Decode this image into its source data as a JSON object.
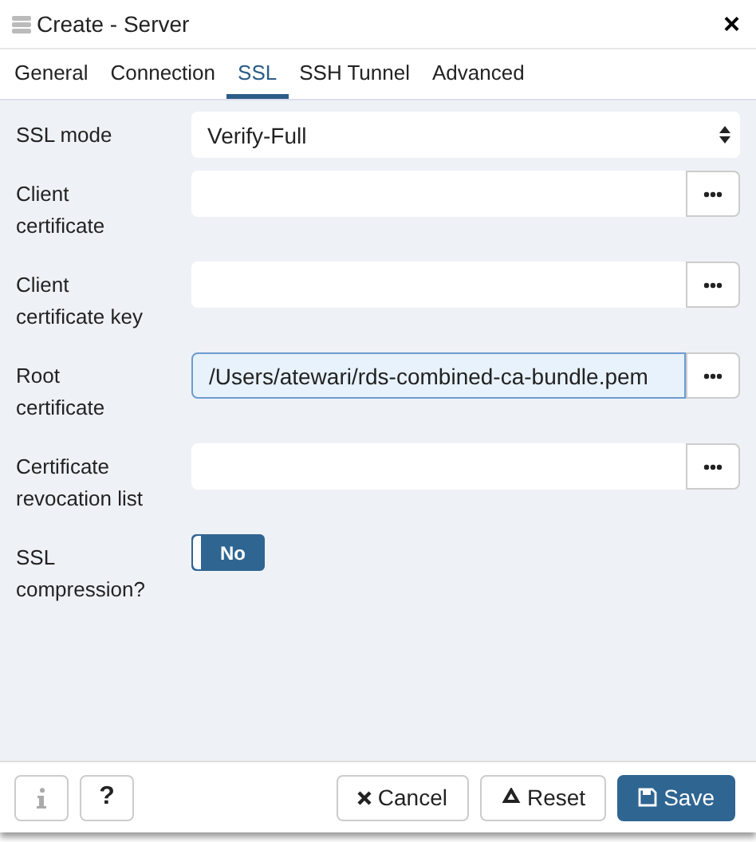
{
  "window": {
    "title": "Create - Server",
    "close": "×"
  },
  "tabs": [
    {
      "label": "General",
      "selected": false
    },
    {
      "label": "Connection",
      "selected": false
    },
    {
      "label": "SSL",
      "selected": true
    },
    {
      "label": "SSH Tunnel",
      "selected": false
    },
    {
      "label": "Advanced",
      "selected": false
    }
  ],
  "fields": [
    {
      "kind": "select",
      "label": "SSL mode",
      "value": "Verify-Full"
    },
    {
      "kind": "file",
      "label": "Client certificate",
      "focused": false
    },
    {
      "kind": "file",
      "label": "Client certificate key",
      "focused": false
    },
    {
      "kind": "file",
      "label": "Root certificate",
      "value": "/Users/atewari/rds-combined-ca-bundle.pem",
      "focused": true
    },
    {
      "kind": "file",
      "label": "Certificate revocation list",
      "focused": false
    },
    {
      "kind": "toggle",
      "label": "SSL compression?",
      "on": false,
      "text": "No"
    }
  ],
  "footer": {
    "help": "?",
    "cancel": "Cancel",
    "reset": "Reset",
    "save": "Save"
  }
}
